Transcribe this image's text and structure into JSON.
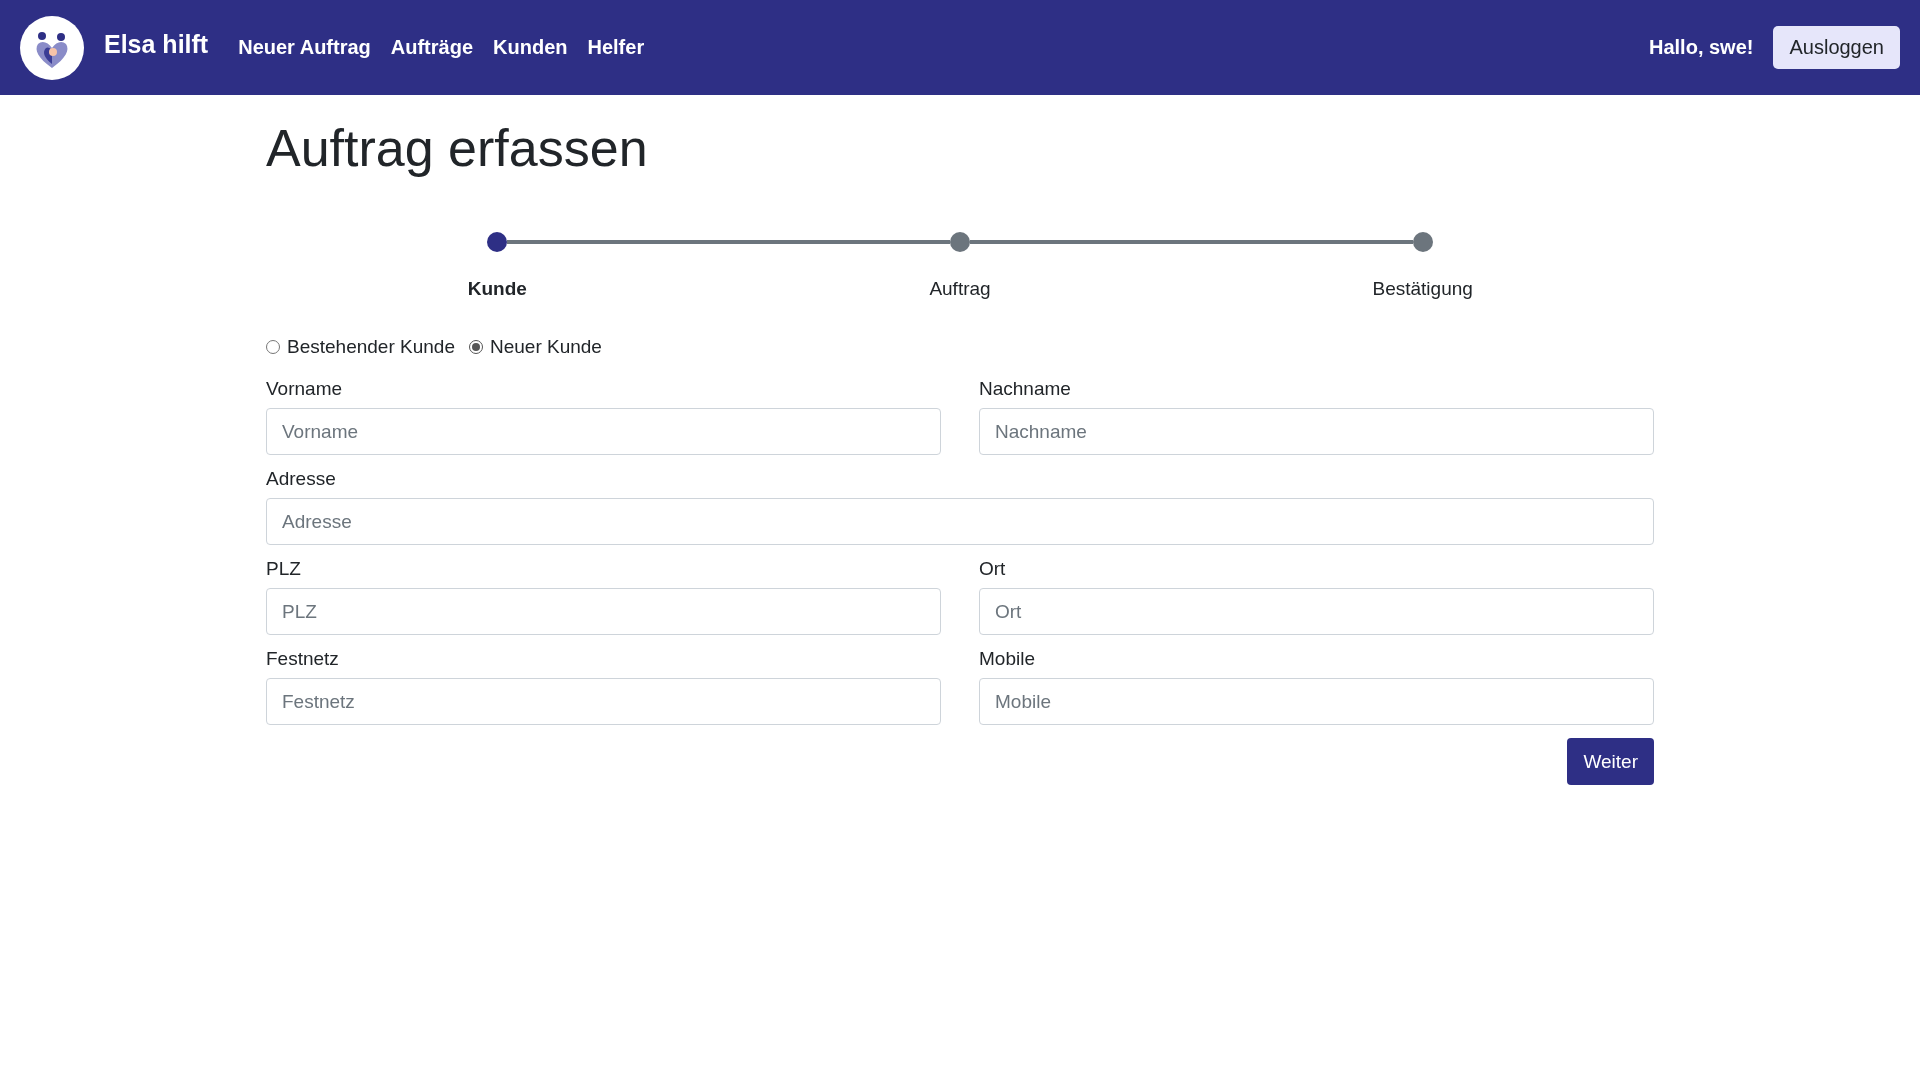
{
  "navbar": {
    "brand": "Elsa hilft",
    "links": [
      "Neuer Auftrag",
      "Aufträge",
      "Kunden",
      "Helfer"
    ],
    "greeting": "Hallo, swe!",
    "logout": "Ausloggen"
  },
  "title": "Auftrag erfassen",
  "steps": [
    {
      "label": "Kunde",
      "selected": true
    },
    {
      "label": "Auftrag",
      "selected": false
    },
    {
      "label": "Bestätigung",
      "selected": false
    }
  ],
  "customer_type": [
    {
      "label": "Bestehender Kunde",
      "selected": false
    },
    {
      "label": "Neuer Kunde",
      "selected": true
    }
  ],
  "form_rows": [
    [
      {
        "label": "Vorname",
        "placeholder": "Vorname"
      },
      {
        "label": "Nachname",
        "placeholder": "Nachname"
      }
    ],
    [
      {
        "label": "Adresse",
        "placeholder": "Adresse"
      }
    ],
    [
      {
        "label": "PLZ",
        "placeholder": "PLZ"
      },
      {
        "label": "Ort",
        "placeholder": "Ort"
      }
    ],
    [
      {
        "label": "Festnetz",
        "placeholder": "Festnetz"
      },
      {
        "label": "Mobile",
        "placeholder": "Mobile"
      }
    ]
  ],
  "next_button": "Weiter"
}
